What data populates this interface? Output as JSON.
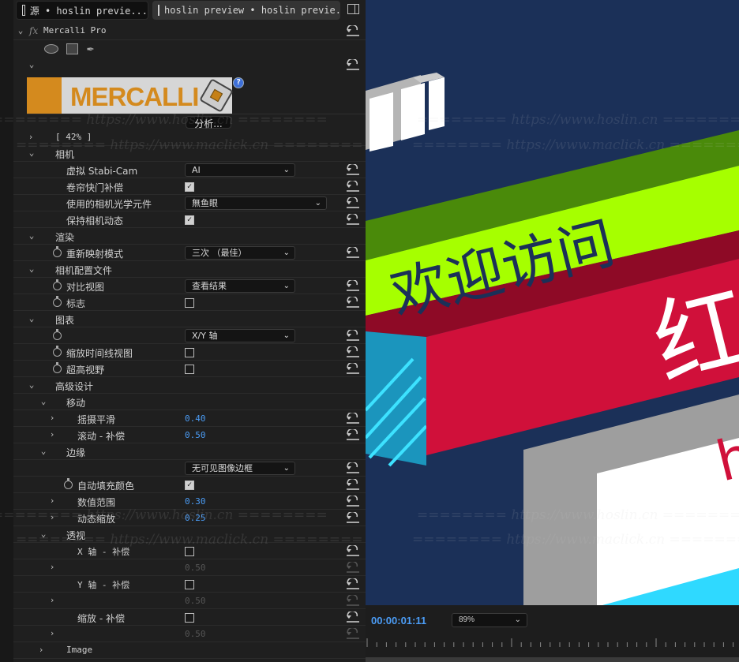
{
  "tabs": [
    {
      "icon": "source-monitor-icon",
      "label": "源 • hoslin previe..."
    },
    {
      "icon": "effect-controls-icon",
      "label": "hoslin preview • hoslin previe..."
    }
  ],
  "effect": {
    "fx_label": "fx",
    "name": "Mercalli Pro",
    "logo_text": "MERCALLI",
    "analyze_button": "分析...",
    "progress": "[ 42% ]",
    "help_icon": "?"
  },
  "mask_tools": [
    "ellipse-mask-icon",
    "rectangle-mask-icon",
    "pen-mask-icon"
  ],
  "rows": [
    {
      "level": 0,
      "chev": "down",
      "label": "相机"
    },
    {
      "level": 1,
      "label": "虚拟 Stabi-Cam",
      "control": "dropdown",
      "value": "AI",
      "reset": true
    },
    {
      "level": 1,
      "label": "卷帘快门补偿",
      "control": "checkbox",
      "checked": true,
      "reset": true
    },
    {
      "level": 1,
      "label": "使用的相机光学元件",
      "control": "dropdown",
      "wide": true,
      "value": "無鱼眼",
      "reset": true
    },
    {
      "level": 1,
      "label": "保持相机动态",
      "control": "checkbox",
      "checked": true,
      "reset": true
    },
    {
      "level": 0,
      "chev": "down",
      "label": "渲染"
    },
    {
      "level": 1,
      "stopwatch": true,
      "label": "重新映射模式",
      "control": "dropdown",
      "value": "三次  （最佳）",
      "reset": true
    },
    {
      "level": 0,
      "chev": "down",
      "label": "相机配置文件"
    },
    {
      "level": 1,
      "stopwatch": true,
      "label": "对比视图",
      "control": "dropdown",
      "value": "查看结果",
      "reset": true
    },
    {
      "level": 1,
      "stopwatch": true,
      "label": "标志",
      "control": "checkbox",
      "checked": false,
      "reset": true
    },
    {
      "level": 0,
      "chev": "down",
      "label": "图表"
    },
    {
      "level": 1,
      "stopwatch": true,
      "label": "",
      "control": "dropdown",
      "value": "X/Y 轴",
      "reset": true
    },
    {
      "level": 1,
      "stopwatch": true,
      "label": "缩放时间线视图",
      "control": "checkbox",
      "checked": false,
      "reset": true
    },
    {
      "level": 1,
      "stopwatch": true,
      "label": "超高视野",
      "control": "checkbox",
      "checked": false,
      "reset": true
    },
    {
      "level": 0,
      "chev": "down",
      "label": "高级设计"
    },
    {
      "level": 1,
      "chev": "down",
      "label": "移动"
    },
    {
      "level": 2,
      "chev": "right",
      "label": "摇摄平滑",
      "control": "value",
      "value": "0.40",
      "reset": true
    },
    {
      "level": 2,
      "chev": "right",
      "label": "滚动 - 补偿",
      "control": "value",
      "value": "0.50",
      "reset": true
    },
    {
      "level": 1,
      "chev": "down",
      "label": "边缘"
    },
    {
      "level": 2,
      "label": "",
      "control": "dropdown",
      "value": "无可见图像边框",
      "reset": true
    },
    {
      "level": 2,
      "stopwatch": true,
      "label": "自动填充颜色",
      "control": "checkbox",
      "checked": true,
      "reset": true
    },
    {
      "level": 2,
      "chev": "right",
      "label": "数值范围",
      "control": "value",
      "value": "0.30",
      "reset": true
    },
    {
      "level": 2,
      "chev": "right",
      "label": "动态缩放",
      "control": "value",
      "value": "0.25",
      "reset": true
    },
    {
      "level": 1,
      "chev": "down",
      "label": "透视"
    },
    {
      "level": 2,
      "label": "X 轴 - 补偿",
      "control": "checkbox",
      "checked": false,
      "reset": true
    },
    {
      "level": 2,
      "chev": "right",
      "label": "",
      "control": "disabled-value",
      "value": "0.50",
      "reset": "disabled"
    },
    {
      "level": 2,
      "label": "Y 轴 - 补偿",
      "control": "checkbox",
      "checked": false,
      "reset": true
    },
    {
      "level": 2,
      "chev": "right",
      "label": "",
      "control": "disabled-value",
      "value": "0.50",
      "reset": "disabled"
    },
    {
      "level": 2,
      "label": "缩放 - 补偿",
      "control": "checkbox",
      "checked": false,
      "reset": true
    },
    {
      "level": 2,
      "chev": "right",
      "label": "",
      "control": "disabled-value",
      "value": "0.50",
      "reset": "disabled"
    },
    {
      "level": "image",
      "chev": "right",
      "label": "Image"
    }
  ],
  "watermarks": {
    "hoslin": "======== https://www.hoslin.cn ========",
    "maclick": "======== https://www.maclick.cn ========"
  },
  "preview": {
    "headline": "欢迎访问",
    "big_char": "红",
    "partial_char": "h"
  },
  "monitor": {
    "timecode": "00:00:01:11",
    "zoom": "89%"
  },
  "colors": {
    "accent": "#4b9cf5",
    "logo_orange": "#d48a1e",
    "lime": "#a6ff00",
    "red": "#d0103a",
    "navy": "#1b3058"
  }
}
